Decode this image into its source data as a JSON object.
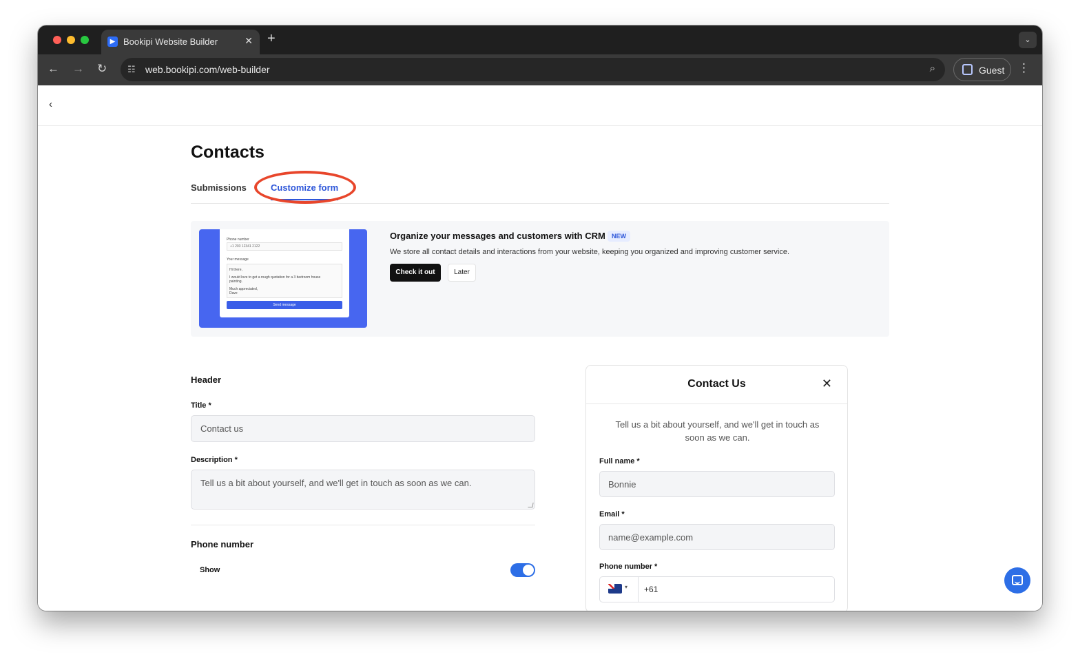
{
  "browser": {
    "tab_title": "Bookipi Website Builder",
    "url": "web.bookipi.com/web-builder",
    "profile_label": "Guest"
  },
  "page": {
    "title": "Contacts",
    "tabs": [
      {
        "label": "Submissions",
        "active": false
      },
      {
        "label": "Customize form",
        "active": true
      }
    ]
  },
  "crm_banner": {
    "heading": "Organize your messages and customers with CRM",
    "badge": "NEW",
    "text": "We store all contact details and interactions from your website, keeping you organized and improving customer service.",
    "primary_button": "Check it out",
    "secondary_button": "Later",
    "preview": {
      "phone_label": "Phone number",
      "phone_value": "+1 203 12341 2122",
      "message_label": "Your message",
      "message_greeting": "Hi there,",
      "message_body": "I would love to get a rough quotation for a 3 bedroom house painting.",
      "message_sign": "Much appreciated,",
      "message_name": "Dave",
      "button": "Send message"
    }
  },
  "form": {
    "section_header": "Header",
    "title_label": "Title *",
    "title_value": "Contact us",
    "description_label": "Description *",
    "description_value": "Tell us a bit about yourself, and we'll get in touch as soon as we can.",
    "phone_section": "Phone number",
    "show_label": "Show",
    "show_enabled": true
  },
  "preview": {
    "title": "Contact Us",
    "description": "Tell us a bit about yourself, and we'll get in touch as soon as we can.",
    "full_name_label": "Full name *",
    "full_name_value": "Bonnie",
    "email_label": "Email *",
    "email_placeholder": "name@example.com",
    "phone_label": "Phone number *",
    "phone_code": "+61"
  },
  "colors": {
    "accent": "#2d56d9",
    "annotation": "#e8462b"
  }
}
